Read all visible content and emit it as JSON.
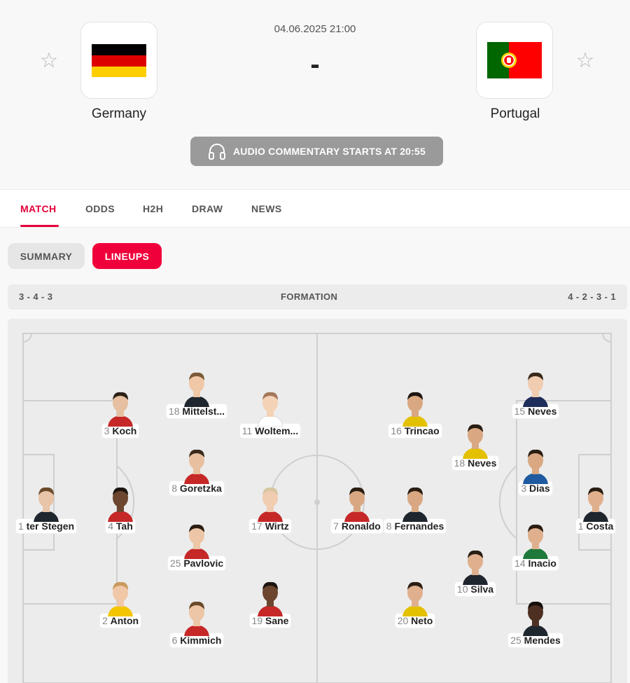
{
  "match": {
    "datetime": "04.06.2025 21:00",
    "score": "-",
    "home": {
      "name": "Germany",
      "flag": "germany-flag"
    },
    "away": {
      "name": "Portugal",
      "flag": "portugal-flag"
    },
    "audio_commentary": "AUDIO COMMENTARY STARTS AT 20:55"
  },
  "colors": {
    "accent": "#e3003a",
    "pill_active": "#f0003a",
    "audio_bg": "#9a9a9a"
  },
  "tabs": [
    {
      "label": "MATCH",
      "active": true
    },
    {
      "label": "ODDS",
      "active": false
    },
    {
      "label": "H2H",
      "active": false
    },
    {
      "label": "DRAW",
      "active": false
    },
    {
      "label": "NEWS",
      "active": false
    }
  ],
  "subtabs": [
    {
      "label": "SUMMARY",
      "active": false
    },
    {
      "label": "LINEUPS",
      "active": true
    }
  ],
  "formation": {
    "label": "FORMATION",
    "home": "3 - 4 - 3",
    "away": "4 - 2 - 3 - 1"
  },
  "players": {
    "home": [
      {
        "num": "1",
        "name": "ter Stegen",
        "shirt": "#20262e",
        "skin": "#e8c4a8",
        "hair": "#6b4a2b"
      },
      {
        "num": "3",
        "name": "Koch",
        "shirt": "#c62828",
        "skin": "#e6c0a0",
        "hair": "#2b2016"
      },
      {
        "num": "4",
        "name": "Tah",
        "shirt": "#c62828",
        "skin": "#6d4630",
        "hair": "#1d1510"
      },
      {
        "num": "2",
        "name": "Anton",
        "shirt": "#f2c500",
        "skin": "#f0c8a8",
        "hair": "#c99a5d"
      },
      {
        "num": "18",
        "name": "Mittelst...",
        "shirt": "#20262e",
        "skin": "#f0c8a8",
        "hair": "#7a5a38"
      },
      {
        "num": "8",
        "name": "Goretzka",
        "shirt": "#c62828",
        "skin": "#e8c0a0",
        "hair": "#3a2a1c"
      },
      {
        "num": "25",
        "name": "Pavlovic",
        "shirt": "#c62828",
        "skin": "#ecc6a6",
        "hair": "#2a1d12"
      },
      {
        "num": "6",
        "name": "Kimmich",
        "shirt": "#c62828",
        "skin": "#ecc6a6",
        "hair": "#6b4a2b"
      },
      {
        "num": "11",
        "name": "Woltem...",
        "shirt": "#ffffff",
        "skin": "#f4d2b6",
        "hair": "#a4785a"
      },
      {
        "num": "17",
        "name": "Wirtz",
        "shirt": "#c62828",
        "skin": "#f0ccb0",
        "hair": "#d7c6a0"
      },
      {
        "num": "19",
        "name": "Sane",
        "shirt": "#c62828",
        "skin": "#6d4630",
        "hair": "#1d1510"
      }
    ],
    "away": [
      {
        "num": "7",
        "name": "Ronaldo",
        "shirt": "#c62828",
        "skin": "#d9a882",
        "hair": "#2a1d12"
      },
      {
        "num": "8",
        "name": "Fernandes",
        "shirt": "#20262e",
        "skin": "#d9a882",
        "hair": "#2a1d12"
      },
      {
        "num": "16",
        "name": "Trincao",
        "shirt": "#e3c000",
        "skin": "#d9a882",
        "hair": "#1d1510"
      },
      {
        "num": "18",
        "name": "Neves",
        "shirt": "#e3c000",
        "skin": "#d9a882",
        "hair": "#2a1d12"
      },
      {
        "num": "10",
        "name": "Silva",
        "shirt": "#20262e",
        "skin": "#e0b08e",
        "hair": "#2a1d12"
      },
      {
        "num": "20",
        "name": "Neto",
        "shirt": "#e3c000",
        "skin": "#e0b08e",
        "hair": "#2a1d12"
      },
      {
        "num": "15",
        "name": "Neves",
        "shirt": "#1f2d5a",
        "skin": "#f0ccb0",
        "hair": "#3a2a1c"
      },
      {
        "num": "3",
        "name": "Dias",
        "shirt": "#1f5aa0",
        "skin": "#d9a882",
        "hair": "#2a1d12"
      },
      {
        "num": "14",
        "name": "Inacio",
        "shirt": "#1e7a3a",
        "skin": "#e0b08e",
        "hair": "#2a1d12"
      },
      {
        "num": "25",
        "name": "Mendes",
        "shirt": "#20262e",
        "skin": "#4d3022",
        "hair": "#150f0a"
      },
      {
        "num": "1",
        "name": "Costa",
        "shirt": "#20262e",
        "skin": "#e0b08e",
        "hair": "#2a1d12"
      }
    ]
  }
}
